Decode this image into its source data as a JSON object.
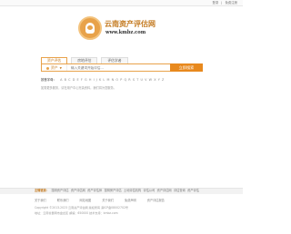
{
  "top": {
    "links": [
      "登录",
      "|",
      "免费注册"
    ]
  },
  "brand": {
    "title": "云南资产评估网",
    "url": "www.kmbz.com"
  },
  "tabs": [
    {
      "label": "资产评估"
    },
    {
      "label": "房地评估"
    },
    {
      "label": "评估学者"
    }
  ],
  "search": {
    "category": "资产",
    "placeholder": "输入关键词开始评估...",
    "button": "立即搜索"
  },
  "alpha": {
    "label": "按首字母：",
    "letters": [
      "A",
      "B",
      "C",
      "D",
      "E",
      "F",
      "G",
      "H",
      "I",
      "J",
      "K",
      "L",
      "M",
      "N",
      "O",
      "P",
      "Q",
      "R",
      "S",
      "T",
      "U",
      "V",
      "W",
      "X",
      "Y",
      "Z"
    ]
  },
  "hint": "如需更多服务，请在用户中心完善资料，我们将为您服务。",
  "friend_links": {
    "title": "友情链接：",
    "items": [
      "昆明资产评估",
      "资产评估网",
      "资产评估师",
      "昆明房产评估",
      "土地评估机构",
      "评估公司",
      "资产评估网",
      "评估查询",
      "资产评估"
    ]
  },
  "footer_nav": [
    "关于我们",
    "联系我们",
    "网站地图",
    "关于我们",
    "免费声明",
    "资产评估报告"
  ],
  "copyright": {
    "line1": "Copyright ©2013-2023 云南资产评估网  版权所有  滇ICP备08002702号",
    "line2": "地址：云南省昆明市盘龙区  邮编：650000  技术支持：kmbz.com"
  }
}
